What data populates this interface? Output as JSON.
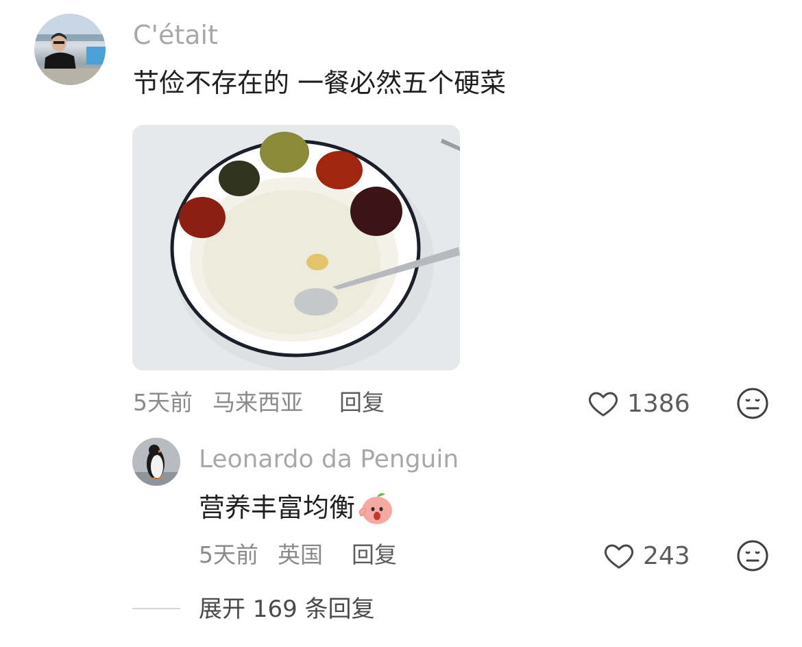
{
  "comment": {
    "author": "C'était",
    "text": "节俭不存在的 一餐必然五个硬菜",
    "time": "5天前",
    "location": "马来西亚",
    "reply_label": "回复",
    "likes": "1386",
    "image_alt": "rice porridge bowl with five condiments"
  },
  "reply": {
    "author": "Leonardo da Penguin",
    "text": "营养丰富均衡",
    "emoji_name": "surprised-peach-emoji",
    "time": "5天前",
    "location": "英国",
    "reply_label": "回复",
    "likes": "243"
  },
  "expand": {
    "label": "展开 169 条回复"
  },
  "icons": {
    "like": "heart-icon",
    "dislike": "meh-face-icon"
  }
}
